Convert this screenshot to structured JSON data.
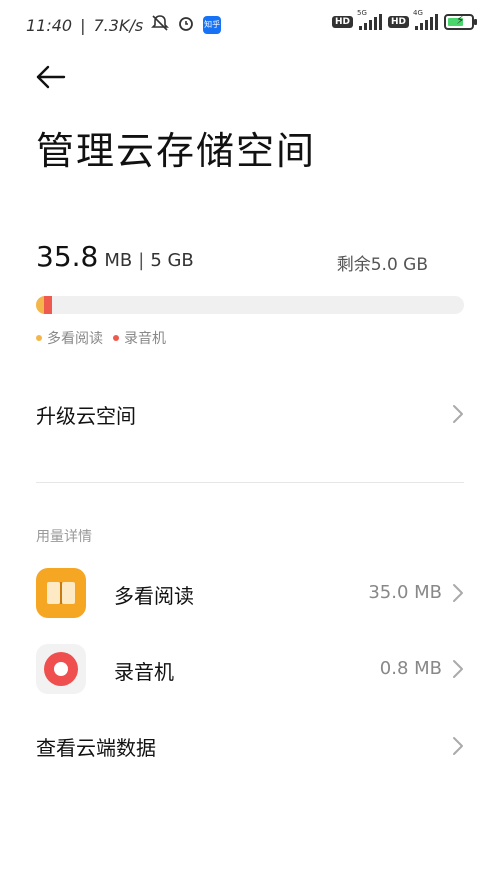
{
  "status_bar": {
    "time": "11:40",
    "speed": "7.3K/s",
    "zhihu_label": "知乎",
    "hd1": "HD",
    "net1": "5G",
    "hd2": "HD",
    "net2": "4G",
    "battery_level": 0.7,
    "icons": [
      "mute-icon",
      "alarm-icon",
      "zhihu-icon",
      "signal-icon",
      "battery-icon"
    ]
  },
  "page": {
    "title": "管理云存储空间"
  },
  "storage": {
    "used_value": "35.8",
    "used_unit": "MB",
    "separator": "|",
    "total": "5 GB",
    "remaining": "剩余5.0 GB",
    "segments": [
      {
        "name": "多看阅读",
        "color": "#f3b64a",
        "fraction": 0.018
      },
      {
        "name": "录音机",
        "color": "#ef5a4f",
        "fraction": 0.013
      }
    ]
  },
  "actions": {
    "upgrade": "升级云空间",
    "view_cloud": "查看云端数据"
  },
  "usage": {
    "section_title": "用量详情",
    "apps": [
      {
        "name": "多看阅读",
        "size": "35.0 MB",
        "icon": "book-icon"
      },
      {
        "name": "录音机",
        "size": "0.8 MB",
        "icon": "recorder-icon"
      }
    ]
  }
}
